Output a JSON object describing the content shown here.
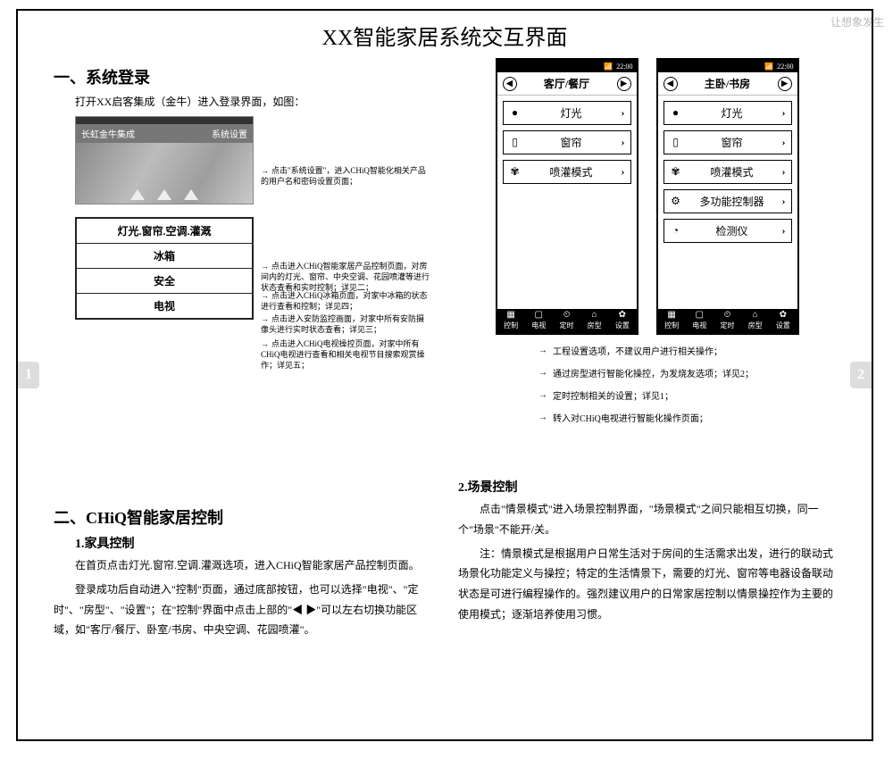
{
  "watermark": "让想象发生",
  "title": "XX智能家居系统交互界面",
  "page_left_num": "1",
  "page_right_num": "2",
  "section1": {
    "heading": "一、系统登录",
    "intro": "打开XX启客集成（金牛）进入登录界面，如图：",
    "login_header_left": "长虹金牛集成",
    "login_header_right": "系统设置",
    "menu": [
      "灯光.窗帘.空调.灌溉",
      "冰箱",
      "安全",
      "电视"
    ],
    "annos": [
      "点击\"系统设置\"，进入CHiQ智能化相关产品的用户名和密码设置页面；",
      "点击进入CHiQ智能家居产品控制页面，对房间内的灯光、窗帘、中央空调、花园喷灌等进行状态查看和实时控制；详见二；",
      "点击进入CHiQ冰箱页面，对家中冰箱的状态进行查看和控制；详见四；",
      "点击进入安防监控画面，对家中所有安防摄像头进行实时状态查看；详见三；",
      "点击进入CHiQ电视操控页面，对家中所有CHiQ电视进行查看和相关电视节目搜索观赏操作；详见五；"
    ]
  },
  "section2": {
    "heading": "二、CHiQ智能家居控制",
    "sub1": "1.家具控制",
    "para1": "在首页点击灯光.窗帘.空调.灌溉选项，进入CHiQ智能家居产品控制页面。",
    "para2": "登录成功后自动进入\"控制\"页面，通过底部按钮，也可以选择\"电视\"、\"定时\"、\"房型\"、\"设置\"；在\"控制\"界面中点击上部的\"◀ ▶\"可以左右切换功能区域，如\"客厅/餐厅、卧室/书房、中央空调、花园喷灌\"。",
    "sub2": "2.场景控制",
    "para3": "点击\"情景模式\"进入场景控制界面，\"场景模式\"之间只能相互切换，同一个\"场景\"不能开/关。",
    "para4": "注：情景模式是根据用户日常生活对于房间的生活需求出发，进行的联动式场景化功能定义与操控；特定的生活情景下，需要的灯光、窗帘等电器设备联动状态是可进行编程操作的。强烈建议用户的日常家居控制以情景操控作为主要的使用模式；逐渐培养使用习惯。"
  },
  "phones": {
    "time": "22:00",
    "left": {
      "room": "客厅/餐厅",
      "items": [
        {
          "icon": "●",
          "label": "灯光"
        },
        {
          "icon": "▯",
          "label": "窗帘"
        },
        {
          "icon": "✾",
          "label": "喷灌模式"
        }
      ]
    },
    "right": {
      "room": "主卧/书房",
      "items": [
        {
          "icon": "●",
          "label": "灯光"
        },
        {
          "icon": "▯",
          "label": "窗帘"
        },
        {
          "icon": "✾",
          "label": "喷灌模式"
        },
        {
          "icon": "⚙",
          "label": "多功能控制器"
        },
        {
          "icon": "◔",
          "label": "检测仪"
        }
      ]
    },
    "bottom": [
      {
        "icon": "▦",
        "label": "控制"
      },
      {
        "icon": "▢",
        "label": "电视"
      },
      {
        "icon": "⏲",
        "label": "定时"
      },
      {
        "icon": "⌂",
        "label": "房型"
      },
      {
        "icon": "✿",
        "label": "设置"
      }
    ],
    "annos": [
      "工程设置选项，不建议用户进行相关操作；",
      "通过房型进行智能化操控，为发烧友选项；详见2；",
      "定时控制相关的设置；详见1；",
      "转入对CHiQ电视进行智能化操作页面；"
    ]
  }
}
